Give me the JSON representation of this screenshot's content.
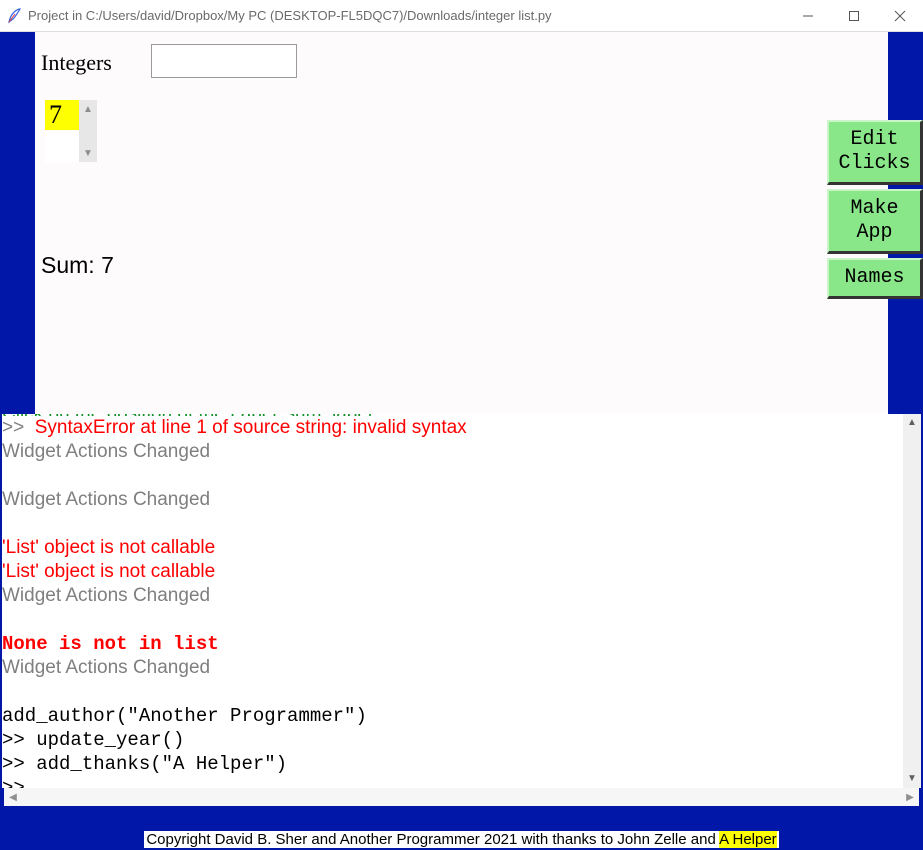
{
  "window": {
    "title": "Project in C:/Users/david/Dropbox/My PC (DESKTOP-FL5DQC7)/Downloads/integer list.py"
  },
  "design": {
    "integers_label": "Integers",
    "entry_value": "",
    "list_items": [
      "7"
    ],
    "list_selected": 0,
    "sum_label": "Sum: 7"
  },
  "buttons": {
    "edit_clicks": "Edit\nClicks",
    "make_app": "Make\nApp",
    "names": "Names"
  },
  "console": {
    "lines": [
      {
        "cls": "green cut",
        "text": "Click on the position of the Label 'sum_label'"
      },
      {
        "cls": "plain",
        "html": [
          {
            "cls": "gray",
            "text": ">>  "
          },
          {
            "cls": "red",
            "text": "SyntaxError at line 1 of source string: invalid syntax"
          }
        ]
      },
      {
        "cls": "gray",
        "text": "Widget Actions Changed"
      },
      {
        "cls": "plain",
        "text": " "
      },
      {
        "cls": "gray",
        "text": "Widget Actions Changed"
      },
      {
        "cls": "plain",
        "text": " "
      },
      {
        "cls": "red",
        "text": "'List' object is not callable"
      },
      {
        "cls": "red",
        "text": "'List' object is not callable"
      },
      {
        "cls": "gray",
        "text": "Widget Actions Changed"
      },
      {
        "cls": "plain",
        "text": " "
      },
      {
        "cls": "red bold mono",
        "text": "None is not in list"
      },
      {
        "cls": "gray",
        "text": "Widget Actions Changed"
      },
      {
        "cls": "plain",
        "text": " "
      },
      {
        "cls": "mono",
        "text": "add_author(\"Another Programmer\")"
      },
      {
        "cls": "mono",
        "text": ">> update_year()"
      },
      {
        "cls": "mono",
        "text": ">> add_thanks(\"A Helper\")"
      },
      {
        "cls": "mono",
        "text": ">> "
      }
    ]
  },
  "footer": {
    "prefix": "Copyright David B. Sher and Another Programmer 2021 with thanks to John Zelle and ",
    "highlight": "A Helper",
    "suffix": " "
  },
  "colors": {
    "blue": "#0017a7",
    "green_btn": "#89e689",
    "yellow": "#feff00"
  }
}
